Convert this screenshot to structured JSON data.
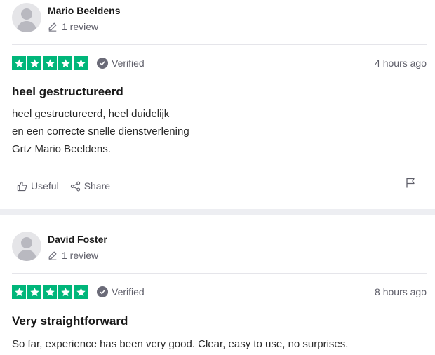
{
  "reviews": [
    {
      "reviewer": "Mario Beeldens",
      "review_count": "1 review",
      "rating": 5,
      "verified_label": "Verified",
      "date": "4 hours ago",
      "title": "heel gestructureerd",
      "body_lines": [
        "heel gestructureerd, heel duidelijk",
        "en een correcte snelle dienstverlening",
        "Grtz Mario Beeldens."
      ],
      "useful_label": "Useful",
      "share_label": "Share"
    },
    {
      "reviewer": "David Foster",
      "review_count": "1 review",
      "rating": 5,
      "verified_label": "Verified",
      "date": "8 hours ago",
      "title": "Very straightforward",
      "body_lines": [
        "So far, experience has been very good. Clear, easy to use, no surprises."
      ]
    }
  ],
  "colors": {
    "star_green": "#00b67a",
    "separator": "#edeef2"
  },
  "icons": [
    "avatar-placeholder-icon",
    "pencil-icon",
    "star-icon",
    "verified-check-icon",
    "thumbs-up-icon",
    "share-icon",
    "flag-icon"
  ]
}
